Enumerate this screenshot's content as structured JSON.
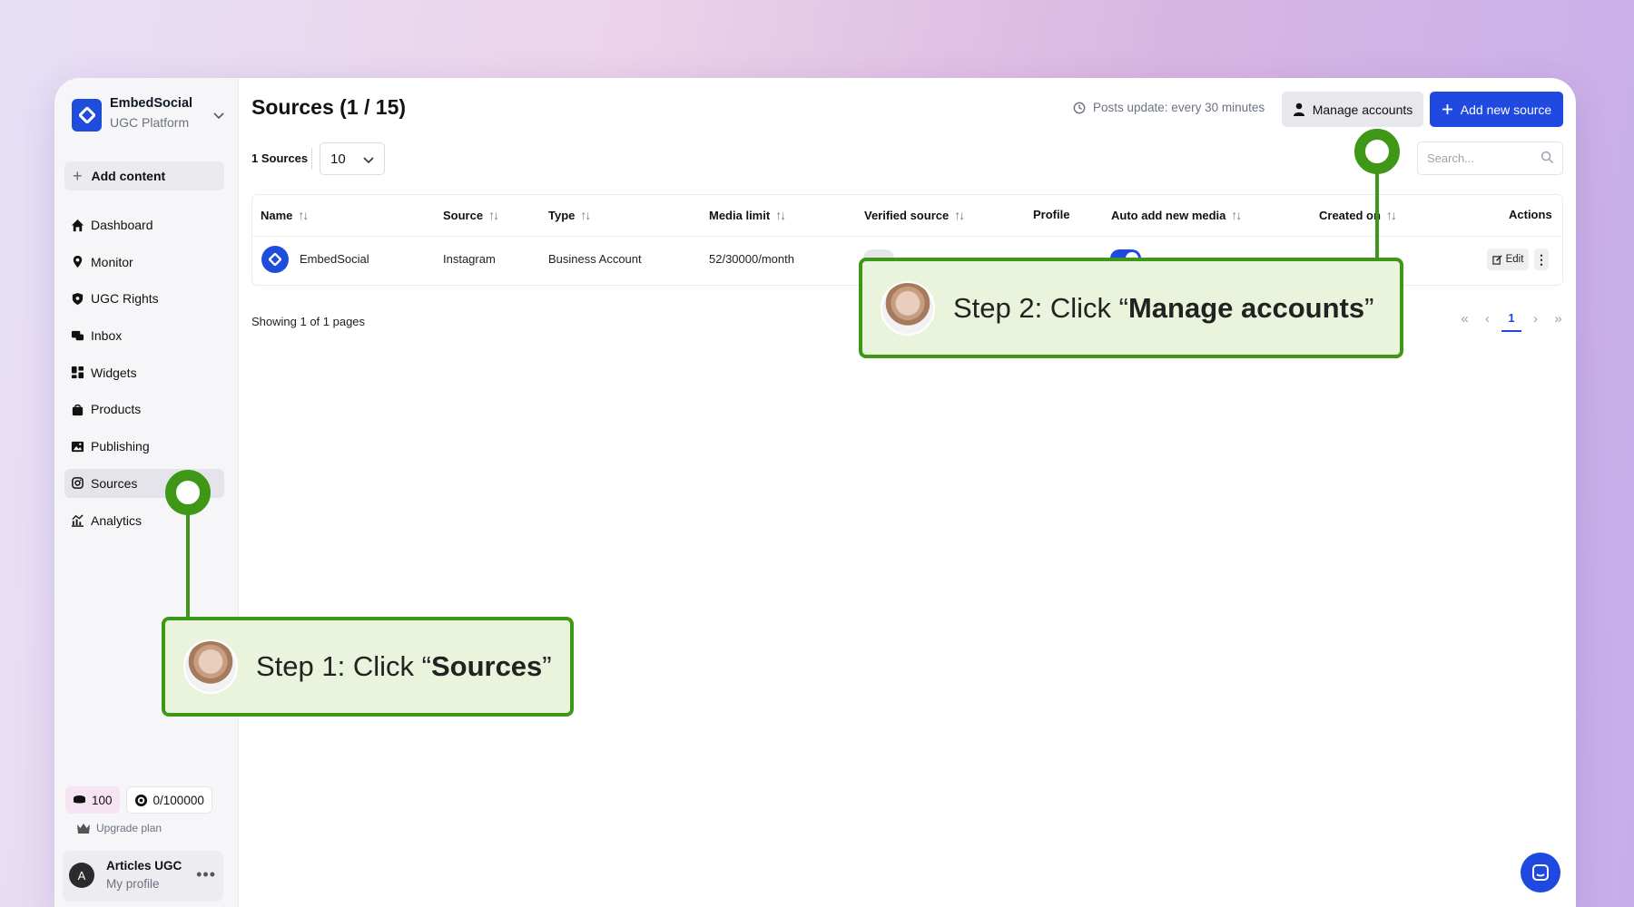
{
  "brand": {
    "name": "EmbedSocial",
    "subtitle": "UGC Platform"
  },
  "sidebar": {
    "add_content": "Add content",
    "items": [
      {
        "label": "Dashboard",
        "icon": "home-icon"
      },
      {
        "label": "Monitor",
        "icon": "location-pin-icon"
      },
      {
        "label": "UGC Rights",
        "icon": "shield-icon"
      },
      {
        "label": "Inbox",
        "icon": "chat-bubbles-icon"
      },
      {
        "label": "Widgets",
        "icon": "widgets-icon"
      },
      {
        "label": "Products",
        "icon": "shopping-bag-icon"
      },
      {
        "label": "Publishing",
        "icon": "image-icon"
      },
      {
        "label": "Sources",
        "icon": "instagram-icon",
        "active": true
      },
      {
        "label": "Analytics",
        "icon": "analytics-icon"
      }
    ],
    "credits": {
      "coins": "100",
      "views": "0/100000"
    },
    "upgrade": "Upgrade plan",
    "profile": {
      "initial": "A",
      "name": "Articles UGC",
      "subtitle": "My profile",
      "more": "•••"
    }
  },
  "header": {
    "title": "Sources (1 / 15)",
    "posts_update": "Posts update: every 30 minutes",
    "manage_accounts": "Manage accounts",
    "add_new_source": "Add new source"
  },
  "toolbar": {
    "sources_count": "1 Sources",
    "page_size": "10",
    "search_placeholder": "Search..."
  },
  "table": {
    "columns": [
      "Name",
      "Source",
      "Type",
      "Media limit",
      "Verified source",
      "Profile",
      "Auto add new media",
      "Created on",
      "Actions"
    ],
    "sort_glyph": "↑↓",
    "rows": [
      {
        "name": "EmbedSocial",
        "source": "Instagram",
        "type": "Business Account",
        "media_limit": "52/30000/month",
        "verified": false,
        "auto_add": true,
        "edit": "Edit",
        "more": "⋮"
      }
    ]
  },
  "footer": {
    "showing": "Showing 1 of 1 pages",
    "pager": {
      "first": "«",
      "prev": "‹",
      "current": "1",
      "next": "›",
      "last": "»"
    }
  },
  "annotations": {
    "step1": {
      "prefix": "Step 1: Click “",
      "bold": "Sources",
      "suffix": "”"
    },
    "step2": {
      "prefix": "Step 2: Click “",
      "bold": "Manage accounts",
      "suffix": "”"
    }
  },
  "colors": {
    "accent": "#1f49e0",
    "callout_green": "#3f9717",
    "callout_bg": "#eaf3dc"
  }
}
